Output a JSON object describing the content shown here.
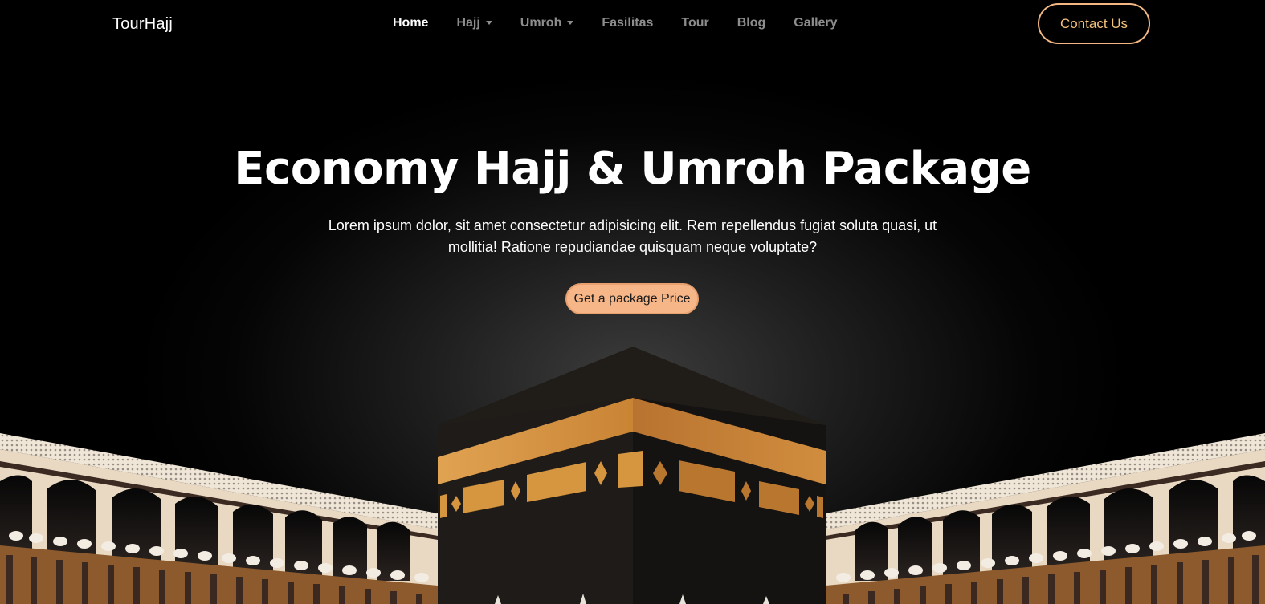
{
  "navbar": {
    "brand": "TourHajj",
    "items": [
      {
        "label": "Home",
        "active": true,
        "dropdown": false
      },
      {
        "label": "Hajj",
        "active": false,
        "dropdown": true
      },
      {
        "label": "Umroh",
        "active": false,
        "dropdown": true
      },
      {
        "label": "Fasilitas",
        "active": false,
        "dropdown": false
      },
      {
        "label": "Tour",
        "active": false,
        "dropdown": false
      },
      {
        "label": "Blog",
        "active": false,
        "dropdown": false
      },
      {
        "label": "Gallery",
        "active": false,
        "dropdown": false
      }
    ],
    "contact_label": "Contact Us"
  },
  "hero": {
    "title": "Economy Hajj & Umroh Package",
    "description": "Lorem ipsum dolor, sit amet consectetur adipisicing elit. Rem repellendus fugiat soluta quasi, ut mollitia! Ratione repudiandae quisquam neque voluptate?",
    "cta_label": "Get a package Price",
    "illustration": "kaaba-mosque-illustration"
  },
  "colors": {
    "accent": "#f7b688",
    "contact_text": "#f4c27a",
    "kaaba_gold": "#d99a4a",
    "background": "#000000"
  }
}
